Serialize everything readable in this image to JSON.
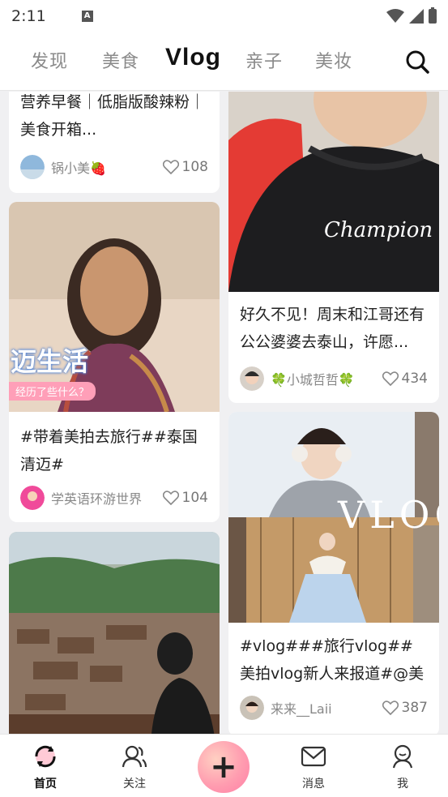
{
  "status_bar": {
    "time": "2:11",
    "notification_icon": "A"
  },
  "top_tabs": [
    {
      "label": "发现"
    },
    {
      "label": "美食"
    },
    {
      "label": "Vlog",
      "active": true
    },
    {
      "label": "亲子"
    },
    {
      "label": "美妆"
    }
  ],
  "feed": {
    "left": [
      {
        "title": "营养早餐｜低脂版酸辣粉｜美食开箱...",
        "author": "锅小美🍓",
        "likes": "108"
      },
      {
        "title": "#带着美拍去旅行##泰国清迈#",
        "author": "学英语环游世界",
        "likes": "104",
        "image_caption": "迈生活",
        "image_subcaption": "经历了些什么？"
      },
      {
        "title": "",
        "author": "",
        "likes": ""
      }
    ],
    "right": [
      {
        "title": "好久不见！周末和江哥还有公公婆婆去泰山，许愿...",
        "author": "🍀小城哲哲🍀",
        "likes": "434",
        "image_caption": "Champion"
      },
      {
        "title": "#vlog###旅行vlog##美拍vlog新人来报道#@美拍...",
        "author": "来来__Laii",
        "likes": "387",
        "image_caption": "VLOG"
      }
    ]
  },
  "bottom_nav": [
    {
      "label": "首页",
      "icon": "home-icon",
      "active": true
    },
    {
      "label": "关注",
      "icon": "follow-icon"
    },
    {
      "label": "",
      "icon": "plus-icon"
    },
    {
      "label": "消息",
      "icon": "message-icon"
    },
    {
      "label": "我",
      "icon": "profile-icon"
    }
  ],
  "colors": {
    "accent_pink": "#ff9db0",
    "background": "#f0f0f2"
  }
}
